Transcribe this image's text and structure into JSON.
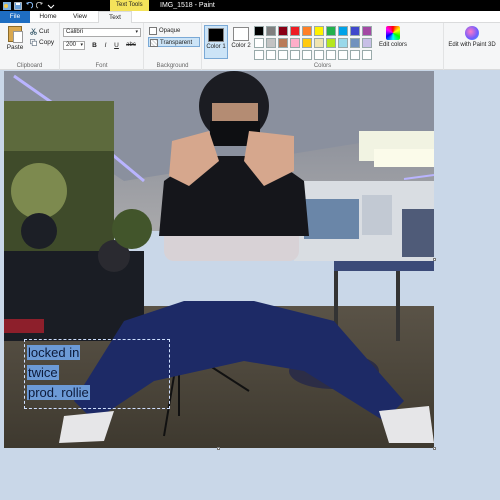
{
  "window": {
    "title": "IMG_1518 - Paint",
    "context_tab": "Text Tools"
  },
  "tabs": [
    {
      "label": "File"
    },
    {
      "label": "Home"
    },
    {
      "label": "View"
    },
    {
      "label": "Text"
    }
  ],
  "clipboard": {
    "paste_label": "Paste",
    "cut_label": "Cut",
    "copy_label": "Copy",
    "group_label": "Clipboard"
  },
  "font": {
    "family": "Calibri",
    "size": "200",
    "bold_label": "B",
    "italic_label": "I",
    "underline_label": "U",
    "strike_label": "abc",
    "group_label": "Font"
  },
  "background": {
    "opaque_label": "Opaque",
    "transparent_label": "Transparent",
    "selected": "transparent",
    "group_label": "Background"
  },
  "colors": {
    "color1_label": "Color 1",
    "color1_value": "#000000",
    "color2_label": "Color 2",
    "color2_value": "#ffffff",
    "palette": [
      "#000000",
      "#7f7f7f",
      "#880015",
      "#ed1c24",
      "#ff7f27",
      "#fff200",
      "#22b14c",
      "#00a2e8",
      "#3f48cc",
      "#a349a4",
      "#ffffff",
      "#c3c3c3",
      "#b97a57",
      "#ffaec9",
      "#ffc90e",
      "#efe4b0",
      "#b5e61d",
      "#99d9ea",
      "#7092be",
      "#c8bfe7",
      "#ffffff",
      "#ffffff",
      "#ffffff",
      "#ffffff",
      "#ffffff",
      "#ffffff",
      "#ffffff",
      "#ffffff",
      "#ffffff",
      "#ffffff"
    ],
    "edit_colors_label": "Edit colors",
    "edit_p3d_label": "Edit with Paint 3D",
    "group_label": "Colors"
  },
  "canvas": {
    "text_lines": [
      "locked in",
      "twice",
      "prod. rollie"
    ]
  }
}
